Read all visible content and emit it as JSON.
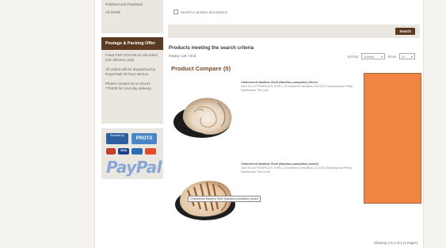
{
  "sidebar": {
    "links": [
      "Polished and Poarlised",
      "All Shells"
    ],
    "postage_title": "Postage & Packing Offer",
    "offer_lines": [
      "Fixed P&P of £3.95 on all orders (UK delivery only).",
      "All orders will be dispatched by Royal Mail 48 hour service.",
      "Please contact us on 01424 775438 for next day delivery."
    ],
    "payment": {
      "secured_label": "Secured by",
      "protx_label": "PROTX",
      "paypal_label": "PayPal",
      "cards": [
        "Maestro",
        "VISA",
        "Delta",
        "MasterCard"
      ]
    }
  },
  "search": {
    "checkbox_label": "Search in product descriptions",
    "button_label": "Search"
  },
  "results": {
    "heading": "Products meeting the search criteria",
    "display_label": "Display:",
    "display_options": [
      "List",
      "Grid"
    ],
    "sort_label": "Sort By:",
    "sort_value": "Default",
    "show_label": "Show:",
    "show_value": "20",
    "compare_label": "Product Compare (0)",
    "showing": "Showing 1 to 2 of 2 (1 Pages)"
  },
  "products": [
    {
      "title": "Chambered Nautilus Shell (Nautilus pompilius) Sliced",
      "desc": "NAUTILUS POMPILIUS SHELL (Chambered Nautilus) SLICED Cephalopoda Phillip Nautiloidae This rare"
    },
    {
      "title": "Chambered Nautilus Shell (Nautilus pompilius) (small)",
      "desc": "NAUTILUS POMPILIUS SHELL (Chambered Nautilus) CLASS Cephalopoda Phillip Nautiloidae This is the"
    }
  ],
  "tooltip": "Chambered Nautilus Shell (Nautilus pompilius) (small)",
  "colors": {
    "accent_brown": "#5b3a22",
    "compare_brown": "#7a4a22",
    "ad_orange": "#f08442"
  }
}
